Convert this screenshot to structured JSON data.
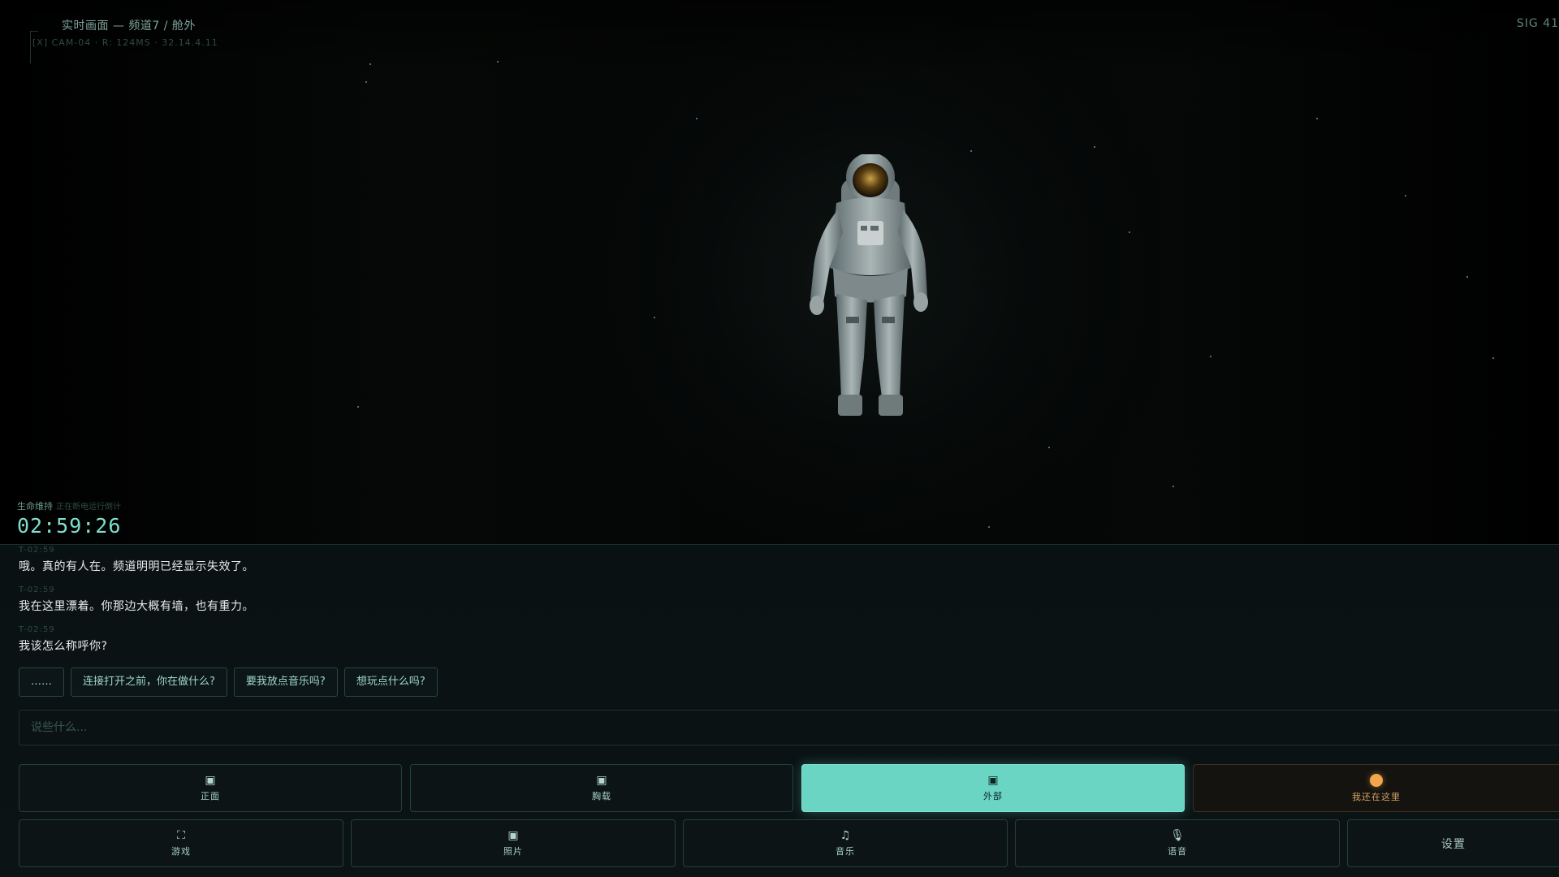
{
  "viewport": {
    "title": "实时画面 — 频道7 / 舱外",
    "meta": "[X] CAM-04 · R: 124MS · 32.14.4.11",
    "signal": "SIG 41"
  },
  "life_support": {
    "label": "生命维持",
    "sublabel": "正在断电运行倒计",
    "timer": "02:59:26"
  },
  "messages": [
    {
      "ts": "T-02:59",
      "text": "哦。真的有人在。频道明明已经显示失效了。"
    },
    {
      "ts": "T-02:59",
      "text": "我在这里漂着。你那边大概有墙，也有重力。"
    },
    {
      "ts": "T-02:59",
      "text": "我该怎么称呼你?"
    }
  ],
  "quick_replies": [
    "……",
    "连接打开之前，你在做什么?",
    "要我放点音乐吗?",
    "想玩点什么吗?"
  ],
  "input": {
    "placeholder": "说些什么..."
  },
  "camera_buttons": [
    {
      "label": "正面",
      "icon": "camera-icon",
      "glyph": "▣"
    },
    {
      "label": "胸载",
      "icon": "camera-icon",
      "glyph": "▣"
    },
    {
      "label": "外部",
      "icon": "camera-icon",
      "glyph": "▣",
      "active": true
    },
    {
      "label": "我还在这里",
      "icon": "status-dot-icon"
    }
  ],
  "tool_buttons": [
    {
      "label": "游戏",
      "icon": "expand-icon",
      "glyph": "⛶"
    },
    {
      "label": "照片",
      "icon": "photo-icon",
      "glyph": "▣"
    },
    {
      "label": "音乐",
      "icon": "music-icon",
      "glyph": "♫"
    },
    {
      "label": "语音",
      "icon": "microphone-icon",
      "glyph": "🎙"
    },
    {
      "label": "设置"
    }
  ],
  "colors": {
    "accent": "#6bd5c4",
    "warn": "#f3a64e",
    "background": "#010202"
  }
}
